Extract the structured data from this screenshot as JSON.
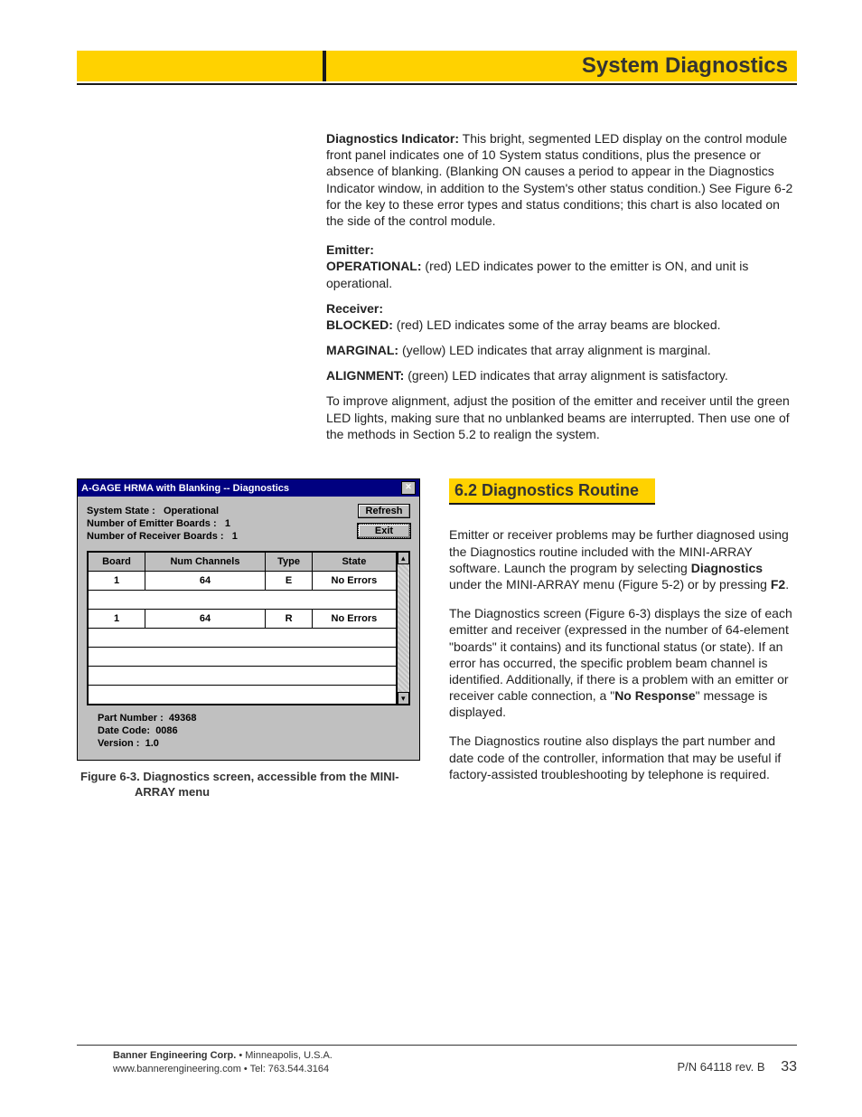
{
  "header": {
    "section_title": "System Diagnostics"
  },
  "body": {
    "diag_indicator_label": "Diagnostics Indicator:",
    "diag_indicator_text": " This bright, segmented LED display on the control module front panel indicates one of 10 System status conditions, plus the presence or absence of blanking. (Blanking ON causes a period to appear in the Diagnostics Indicator window, in addition to the System's other status condition.) See Figure 6-2 for the key to these error types and status conditions; this chart is also located on the side of the control module.",
    "emitter_label": "Emitter:",
    "operational_label": "OPERATIONAL:",
    "operational_text": " (red) LED indicates power to the emitter is ON, and unit is operational.",
    "receiver_label": "Receiver:",
    "blocked_label": "BLOCKED:",
    "blocked_text": " (red) LED indicates some of the array beams are blocked.",
    "marginal_label": "MARGINAL:",
    "marginal_text": " (yellow) LED indicates that array alignment is marginal.",
    "alignment_label": "ALIGNMENT:",
    "alignment_text": " (green) LED indicates that array alignment is satisfactory.",
    "improve_text": "To improve alignment, adjust the position of the emitter and receiver until the green LED lights, making sure that no unblanked beams are interrupted. Then use one of the methods in Section 5.2 to realign the system."
  },
  "dialog": {
    "title": "A-GAGE HRMA with Blanking -- Diagnostics",
    "system_state_label": "System State :",
    "system_state_value": "Operational",
    "emitter_boards_label": "Number of Emitter Boards :",
    "emitter_boards_value": "1",
    "receiver_boards_label": "Number of Receiver Boards :",
    "receiver_boards_value": "1",
    "refresh_btn": "Refresh",
    "exit_btn": "Exit",
    "columns": {
      "c0": "Board",
      "c1": "Num Channels",
      "c2": "Type",
      "c3": "State"
    },
    "rows": [
      {
        "board": "1",
        "channels": "64",
        "type": "E",
        "state": "No Errors"
      },
      {
        "board": "1",
        "channels": "64",
        "type": "R",
        "state": "No Errors"
      }
    ],
    "part_number_label": "Part Number :",
    "part_number_value": "49368",
    "date_code_label": "Date Code:",
    "date_code_value": "0086",
    "version_label": "Version :",
    "version_value": "1.0"
  },
  "caption": "Figure 6-3.  Diagnostics screen, accessible from the MINI-ARRAY menu",
  "section62": {
    "heading": "6.2 Diagnostics Routine",
    "p1a": "Emitter or receiver problems may be further diagnosed using the Diagnostics routine included with the MINI-ARRAY software. Launch the program by selecting ",
    "p1b": "Diagnostics",
    "p1c": " under the MINI-ARRAY menu (Figure 5-2) or by pressing ",
    "p1d": "F2",
    "p1e": ".",
    "p2a": "The Diagnostics screen (Figure 6-3) displays the size of each emitter and receiver (expressed in the number of 64-element \"boards\" it contains) and its functional status (or state). If an error has occurred, the specific problem beam channel is identified. Additionally, if there is a problem with an emitter or receiver cable connection, a \"",
    "p2b": "No Response",
    "p2c": "\" message is displayed.",
    "p3": "The Diagnostics routine also displays the part number and date code of the controller, information that may be useful if factory-assisted troubleshooting by telephone is required."
  },
  "footer": {
    "company": "Banner Engineering Corp.",
    "loc": " • Minneapolis, U.S.A.",
    "line2": "www.bannerengineering.com  •  Tel: 763.544.3164",
    "pn": "P/N 64118 rev. B",
    "page": "33"
  }
}
